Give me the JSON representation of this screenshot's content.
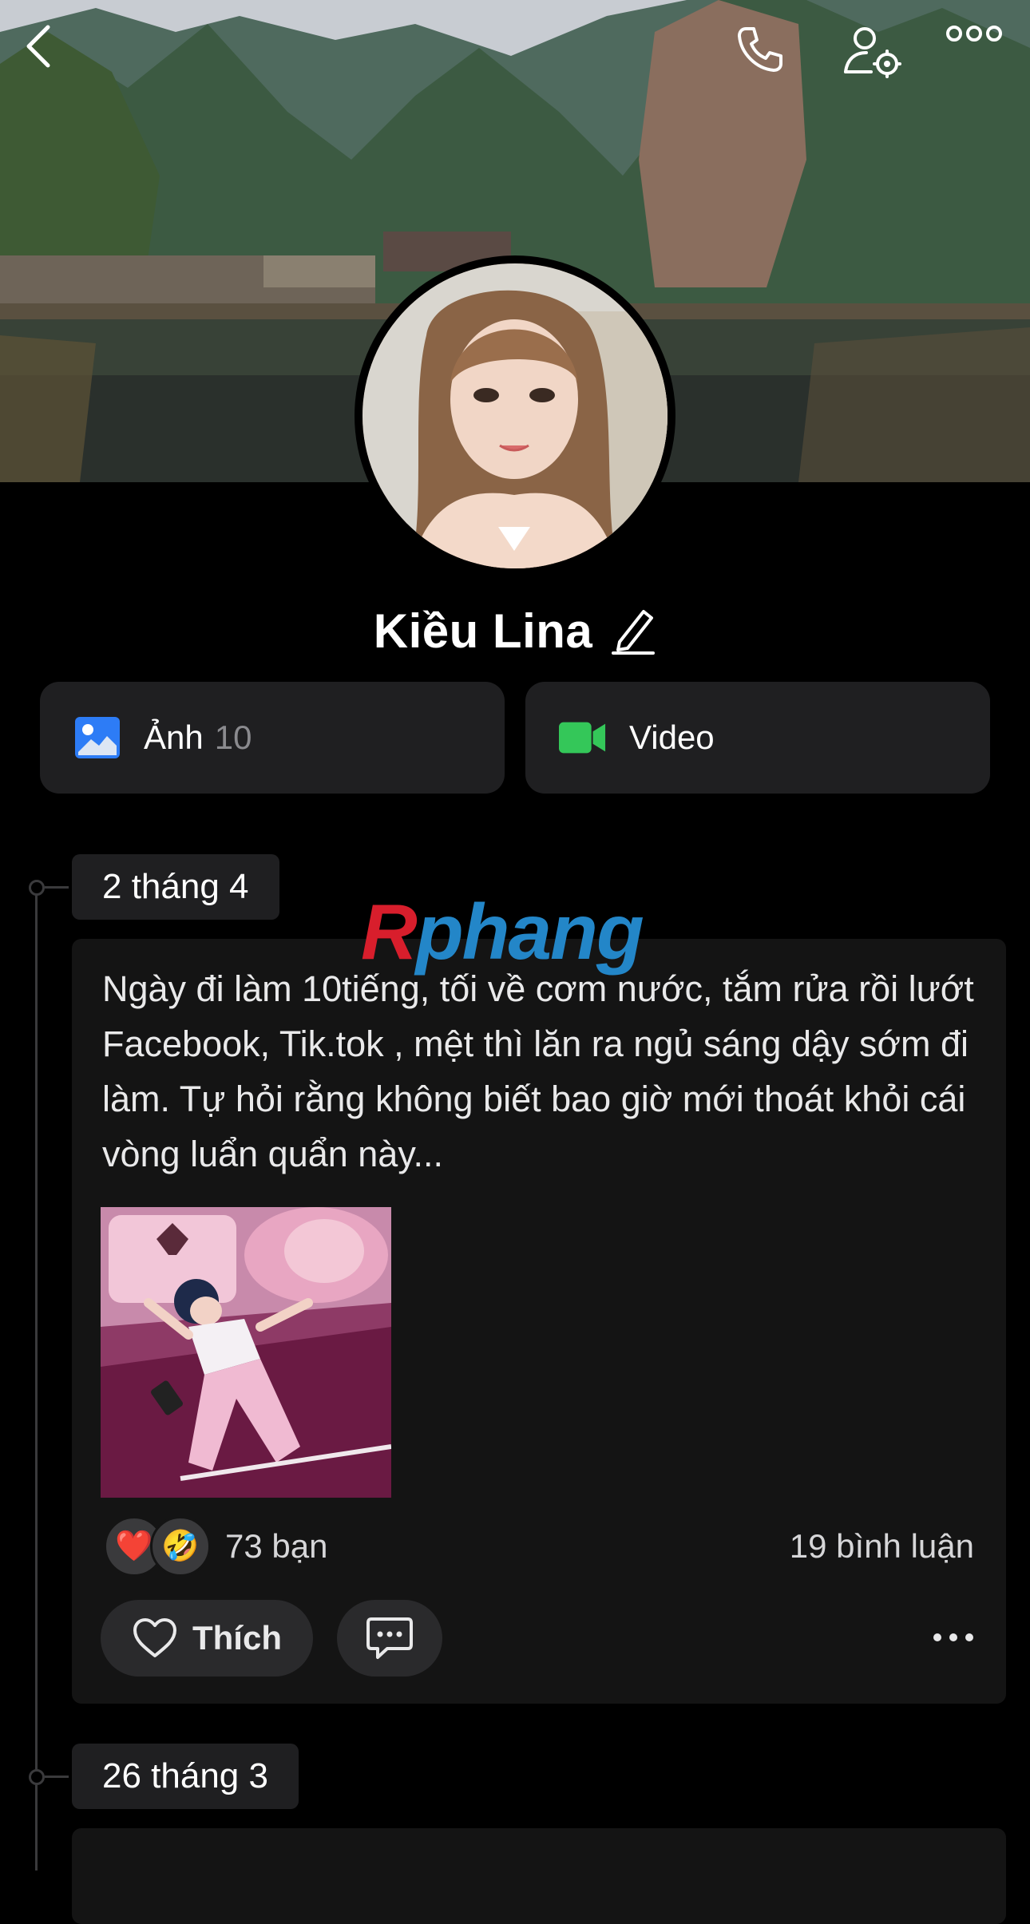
{
  "header": {
    "back_icon": "chevron-left-icon",
    "call_icon": "phone-icon",
    "settings_icon": "user-settings-icon",
    "more_icon": "more-dots-icon"
  },
  "profile": {
    "name": "Kiều Lina",
    "edit_icon": "pencil-icon"
  },
  "media": {
    "photos": {
      "label": "Ảnh",
      "count": "10",
      "icon": "photo-icon",
      "color": "#2d7cf6"
    },
    "video": {
      "label": "Video",
      "icon": "video-camera-icon",
      "color": "#34c759"
    }
  },
  "timeline": [
    {
      "date": "2 tháng 4",
      "text": "Ngày đi làm 10tiếng, tối về cơm nước, tắm rửa rồi lướt Facebook, Tik.tok , mệt thì lăn ra ngủ sáng dậy sớm đi làm. Tự hỏi rằng không biết bao giờ mới thoát khỏi cái vòng luẩn quẩn này...",
      "reactions": [
        "❤️",
        "🤣"
      ],
      "reaction_count": "73 bạn",
      "comment_count": "19 bình luận",
      "like_label": "Thích"
    },
    {
      "date": "26 tháng 3"
    }
  ],
  "watermark": {
    "part1": "R",
    "part2": "phang"
  }
}
